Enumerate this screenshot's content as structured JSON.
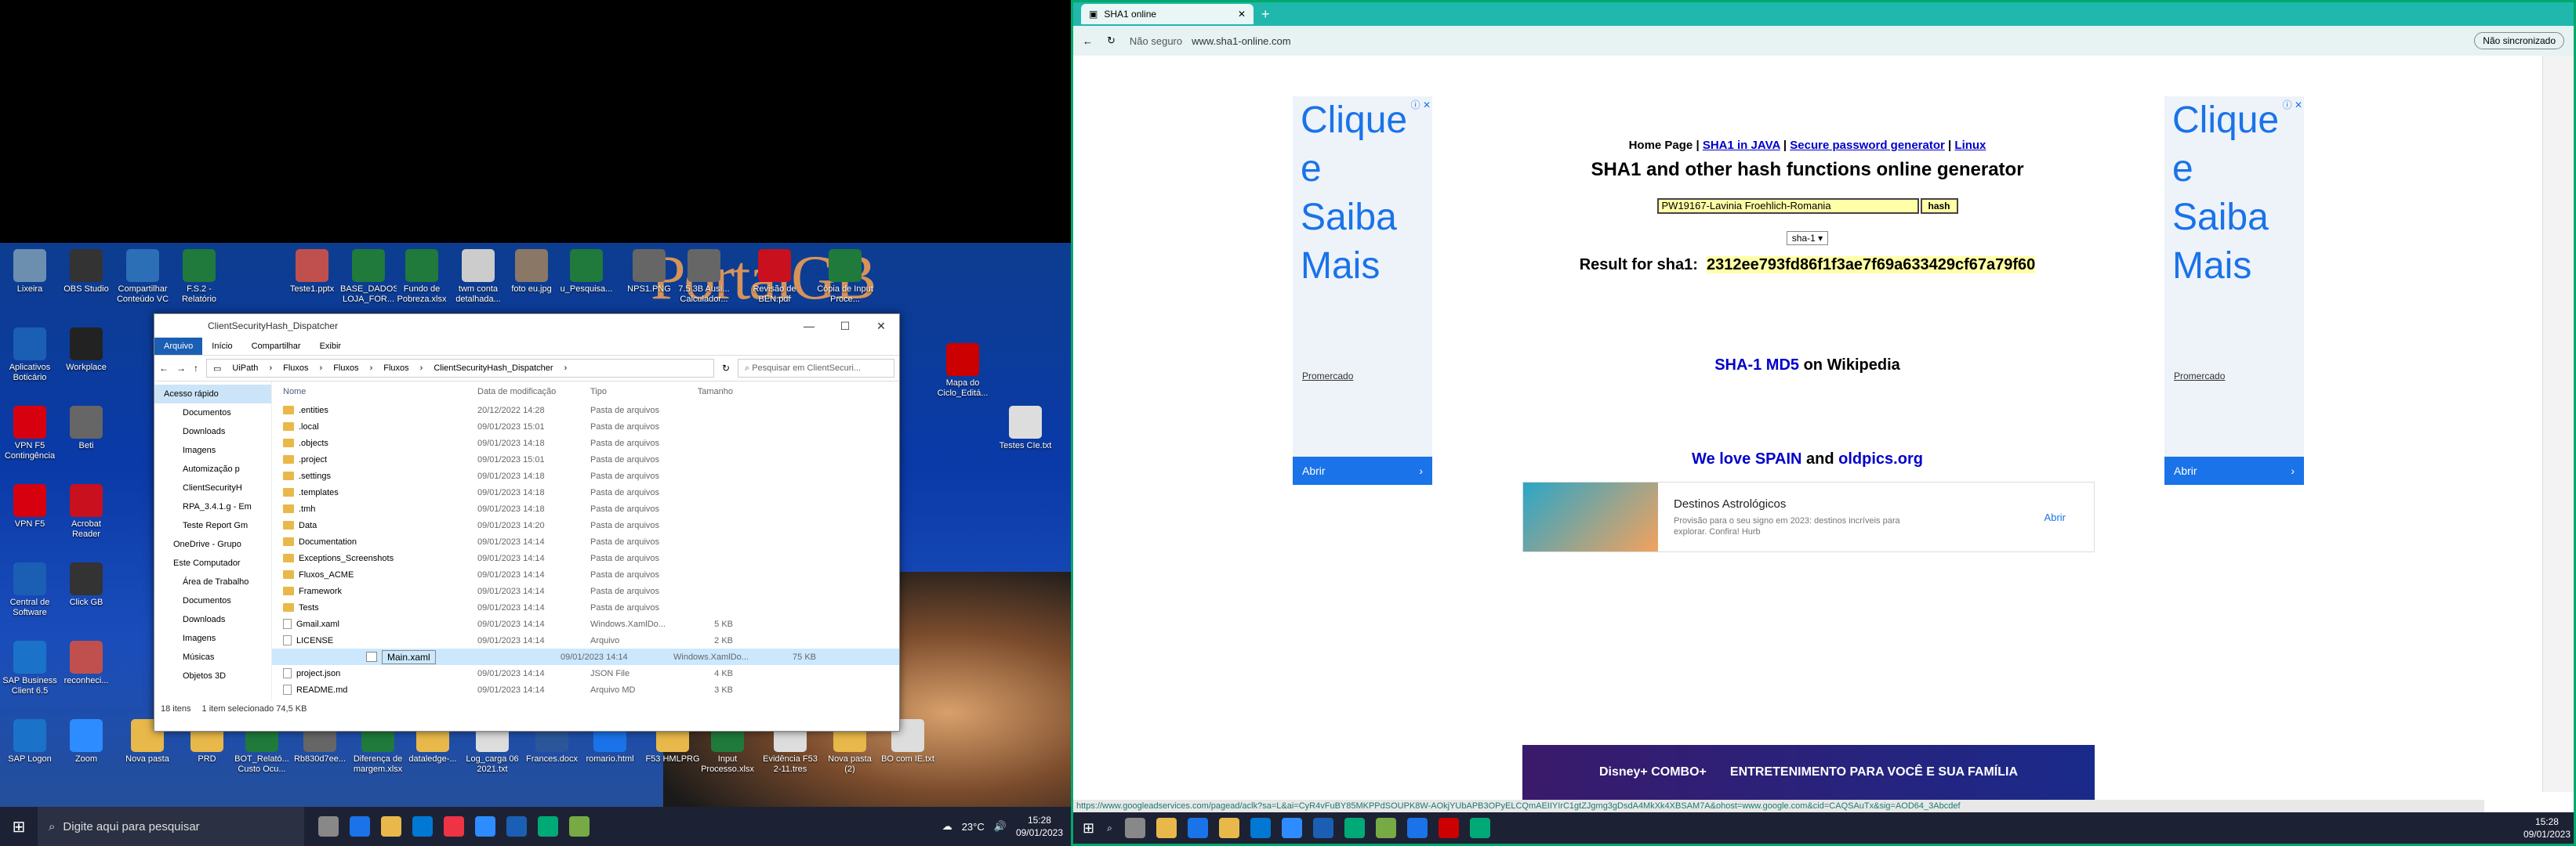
{
  "desktop": {
    "icons": [
      {
        "label": "Lixeira",
        "color": "#6c8fb0"
      },
      {
        "label": "OBS Studio",
        "color": "#333"
      },
      {
        "label": "Compartilhar Conteúdo VC",
        "color": "#2c6fb7"
      },
      {
        "label": "F.S.2 - Relatório",
        "color": "#1f7a3b"
      },
      {
        "label": "Teste1.pptx",
        "color": "#c0504d"
      },
      {
        "label": "BASE_DADOS LOJA_FOR...",
        "color": "#1f7a3b"
      },
      {
        "label": "Fundo de Pobreza.xlsx",
        "color": "#1f7a3b"
      },
      {
        "label": "twm conta detalhada...",
        "color": "#cccccc"
      },
      {
        "label": "foto eu.jpg",
        "color": "#8a7766"
      },
      {
        "label": "u_Pesquisa...",
        "color": "#1f7a3b"
      },
      {
        "label": "Aplicativos Boticário",
        "color": "#1a5fb4"
      },
      {
        "label": "Workplace",
        "color": "#222"
      },
      {
        "label": "VPN F5 Contingência",
        "color": "#d7000f"
      },
      {
        "label": "Beti",
        "color": "#666"
      },
      {
        "label": "VPN F5",
        "color": "#d7000f"
      },
      {
        "label": "Acrobat Reader",
        "color": "#c8101e"
      },
      {
        "label": "Central de Software",
        "color": "#1a5fb4"
      },
      {
        "label": "Click GB",
        "color": "#333"
      },
      {
        "label": "SAP Business Client 6.5",
        "color": "#1a73c8"
      },
      {
        "label": "reconheci...",
        "color": "#c0504d"
      },
      {
        "label": "SAP Logon",
        "color": "#1a73c8"
      },
      {
        "label": "Zoom",
        "color": "#2d8cff"
      },
      {
        "label": "Nova pasta",
        "color": "#e8b84a"
      },
      {
        "label": "PRD",
        "color": "#e8b84a"
      },
      {
        "label": "BOT_Relató... Custo Ocu...",
        "color": "#1f7a3b"
      },
      {
        "label": "Rb830d7ee...",
        "color": "#666"
      },
      {
        "label": "Diferença de margem.xlsx",
        "color": "#1f7a3b"
      },
      {
        "label": "dataledge-...",
        "color": "#e8b84a"
      },
      {
        "label": "Log_carga 06 2021.txt",
        "color": "#ddd"
      },
      {
        "label": "Frances.docx",
        "color": "#2b579a"
      },
      {
        "label": "romario.html",
        "color": "#1a73e8"
      },
      {
        "label": "F53 HMLPRG",
        "color": "#e8b84a"
      },
      {
        "label": "Input Processo.xlsx",
        "color": "#1f7a3b"
      },
      {
        "label": "Evidência F53 2-11.tres",
        "color": "#ddd"
      },
      {
        "label": "Nova pasta (2)",
        "color": "#e8b84a"
      },
      {
        "label": "BO com IE.txt",
        "color": "#ddd"
      },
      {
        "label": "Mapa do Ciclo_Editá...",
        "color": "#c00"
      },
      {
        "label": "Testes CIe.txt",
        "color": "#ddd"
      },
      {
        "label": "NPS1.PNG",
        "color": "#666"
      },
      {
        "label": "7.5 3B Ausí... Calculador...",
        "color": "#666"
      },
      {
        "label": "Revisão de BEN.pdf",
        "color": "#c8101e"
      },
      {
        "label": "Cópia de Input Proce...",
        "color": "#1f7a3b"
      }
    ],
    "wallpaper_text": "PortalGB",
    "wallpaper_url_text": "/portalGB"
  },
  "explorer": {
    "title": "ClientSecurityHash_Dispatcher",
    "ribbon": [
      "Arquivo",
      "Início",
      "Compartilhar",
      "Exibir"
    ],
    "path": [
      "UiPath",
      "Fluxos",
      "Fluxos",
      "Fluxos",
      "ClientSecurityHash_Dispatcher"
    ],
    "search_placeholder": "Pesquisar em ClientSecuri...",
    "nav": [
      {
        "label": "Acesso rápido",
        "cls": "qa"
      },
      {
        "label": "Documentos",
        "cls": "sub"
      },
      {
        "label": "Downloads",
        "cls": "sub"
      },
      {
        "label": "Imagens",
        "cls": "sub"
      },
      {
        "label": "Automização p",
        "cls": "sub"
      },
      {
        "label": "ClientSecurityH",
        "cls": "sub"
      },
      {
        "label": "RPA_3.4.1.g - Em",
        "cls": "sub"
      },
      {
        "label": "Teste Report Gm",
        "cls": "sub"
      },
      {
        "label": "OneDrive - Grupo",
        "cls": ""
      },
      {
        "label": "Este Computador",
        "cls": ""
      },
      {
        "label": "Área de Trabalho",
        "cls": "sub"
      },
      {
        "label": "Documentos",
        "cls": "sub"
      },
      {
        "label": "Downloads",
        "cls": "sub"
      },
      {
        "label": "Imagens",
        "cls": "sub"
      },
      {
        "label": "Músicas",
        "cls": "sub"
      },
      {
        "label": "Objetos 3D",
        "cls": "sub"
      }
    ],
    "columns": [
      "Nome",
      "Data de modificação",
      "Tipo",
      "Tamanho"
    ],
    "files": [
      {
        "name": ".entities",
        "date": "20/12/2022 14:28",
        "type": "Pasta de arquivos",
        "size": "",
        "folder": true
      },
      {
        "name": ".local",
        "date": "09/01/2023 15:01",
        "type": "Pasta de arquivos",
        "size": "",
        "folder": true
      },
      {
        "name": ".objects",
        "date": "09/01/2023 14:18",
        "type": "Pasta de arquivos",
        "size": "",
        "folder": true
      },
      {
        "name": ".project",
        "date": "09/01/2023 15:01",
        "type": "Pasta de arquivos",
        "size": "",
        "folder": true
      },
      {
        "name": ".settings",
        "date": "09/01/2023 14:18",
        "type": "Pasta de arquivos",
        "size": "",
        "folder": true
      },
      {
        "name": ".templates",
        "date": "09/01/2023 14:18",
        "type": "Pasta de arquivos",
        "size": "",
        "folder": true
      },
      {
        "name": ".tmh",
        "date": "09/01/2023 14:18",
        "type": "Pasta de arquivos",
        "size": "",
        "folder": true
      },
      {
        "name": "Data",
        "date": "09/01/2023 14:20",
        "type": "Pasta de arquivos",
        "size": "",
        "folder": true
      },
      {
        "name": "Documentation",
        "date": "09/01/2023 14:14",
        "type": "Pasta de arquivos",
        "size": "",
        "folder": true
      },
      {
        "name": "Exceptions_Screenshots",
        "date": "09/01/2023 14:14",
        "type": "Pasta de arquivos",
        "size": "",
        "folder": true
      },
      {
        "name": "Fluxos_ACME",
        "date": "09/01/2023 14:14",
        "type": "Pasta de arquivos",
        "size": "",
        "folder": true
      },
      {
        "name": "Framework",
        "date": "09/01/2023 14:14",
        "type": "Pasta de arquivos",
        "size": "",
        "folder": true
      },
      {
        "name": "Tests",
        "date": "09/01/2023 14:14",
        "type": "Pasta de arquivos",
        "size": "",
        "folder": true
      },
      {
        "name": "Gmail.xaml",
        "date": "09/01/2023 14:14",
        "type": "Windows.XamlDo...",
        "size": "5 KB",
        "folder": false
      },
      {
        "name": "LICENSE",
        "date": "09/01/2023 14:14",
        "type": "Arquivo",
        "size": "2 KB",
        "folder": false
      },
      {
        "name": "Main.xaml",
        "date": "09/01/2023 14:14",
        "type": "Windows.XamlDo...",
        "size": "75 KB",
        "folder": false,
        "selected": true
      },
      {
        "name": "project.json",
        "date": "09/01/2023 14:14",
        "type": "JSON File",
        "size": "4 KB",
        "folder": false
      },
      {
        "name": "README.md",
        "date": "09/01/2023 14:14",
        "type": "Arquivo MD",
        "size": "3 KB",
        "folder": false
      }
    ],
    "status_count": "18 itens",
    "status_selected": "1 item selecionado  74,5 KB"
  },
  "taskbar1": {
    "search_placeholder": "Digite aqui para pesquisar",
    "weather": "23°C",
    "time": "15:28",
    "date": "09/01/2023",
    "app_colors": [
      "#888",
      "#1a73e8",
      "#e8b84a",
      "#0078d4",
      "#e34",
      "#2d8cff",
      "#1a5fb4",
      "#0a7",
      "#7a4"
    ]
  },
  "browser": {
    "tab_title": "SHA1 online",
    "not_secure": "Não seguro",
    "url": "www.sha1-online.com",
    "sync": "Não sincronizado",
    "nav_links": [
      "Home Page",
      "SHA1 in JAVA",
      "Secure password generator",
      "Linux"
    ],
    "heading": "SHA1 and other hash functions online generator",
    "input_value": "PW19167-Lavinia Froehlich-Romania",
    "hash_button": "hash",
    "algorithm": "sha-1",
    "result_label": "Result for sha1:",
    "result_hash": "2312ee793fd86f1f3ae7f69a633429cf67a79f60",
    "wiki_sha1": "SHA-1",
    "wiki_md5": "MD5",
    "wiki_suffix": "on Wikipedia",
    "spain_link": "We love SPAIN",
    "and": "and",
    "oldpics_link": "oldpics.org",
    "side_ad_text": [
      "Clique",
      "e",
      "Saiba",
      "Mais"
    ],
    "side_ad_promo": "Promercado",
    "side_ad_button": "Abrir",
    "banner_title": "Destinos Astrológicos",
    "banner_desc": "Provisão para o seu signo em 2023: destinos incríveis para explorar. Confira! Hurb",
    "banner_button": "Abrir",
    "bottom_ad_text": "ENTRETENIMENTO PARA VOCÊ E SUA FAMÍLIA",
    "bottom_ad_brand": "Disney+ COMBO+",
    "status_url": "https://www.googleadservices.com/pagead/aclk?sa=L&ai=CyR4vFuBY85MKPPdSOUPK8W-AOkjYUbAPB3OPyELCQmAEIIYIrC1gtZJgmg3gDsdA4MkXk4XBSAM7A&ohost=www.google.com&cid=CAQSAuTx&sig=AOD64_3Abcdef"
  },
  "taskbar2": {
    "time": "15:28",
    "date": "09/01/2023",
    "app_colors": [
      "#888",
      "#e8b84a",
      "#1a73e8",
      "#e8b84a",
      "#0078d4",
      "#2d8cff",
      "#1a5fb4",
      "#0a7",
      "#7a4",
      "#1a73e8",
      "#c00",
      "#0a7"
    ]
  }
}
